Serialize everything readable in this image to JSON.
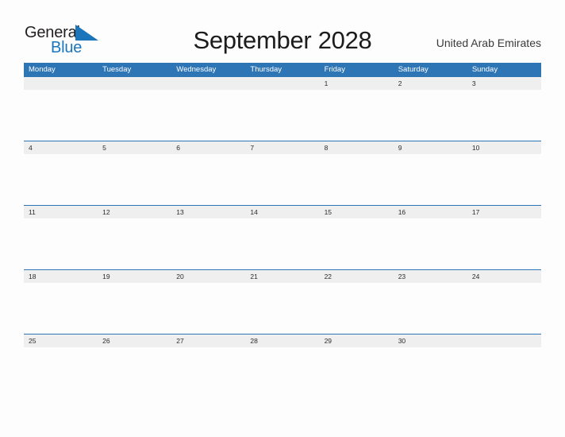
{
  "brand": {
    "name_part1": "General",
    "name_part2": "Blue",
    "flag_icon": "blue-triangle-flag-icon",
    "color_dark": "#231f20",
    "color_blue": "#1b75bb"
  },
  "header": {
    "title": "September 2028",
    "country": "United Arab Emirates"
  },
  "calendar": {
    "header_color": "#2e75b6",
    "date_strip_color": "#efefef",
    "weekdays": [
      "Monday",
      "Tuesday",
      "Wednesday",
      "Thursday",
      "Friday",
      "Saturday",
      "Sunday"
    ],
    "weeks": [
      [
        "",
        "",
        "",
        "",
        "1",
        "2",
        "3"
      ],
      [
        "4",
        "5",
        "6",
        "7",
        "8",
        "9",
        "10"
      ],
      [
        "11",
        "12",
        "13",
        "14",
        "15",
        "16",
        "17"
      ],
      [
        "18",
        "19",
        "20",
        "21",
        "22",
        "23",
        "24"
      ],
      [
        "25",
        "26",
        "27",
        "28",
        "29",
        "30",
        ""
      ]
    ]
  }
}
